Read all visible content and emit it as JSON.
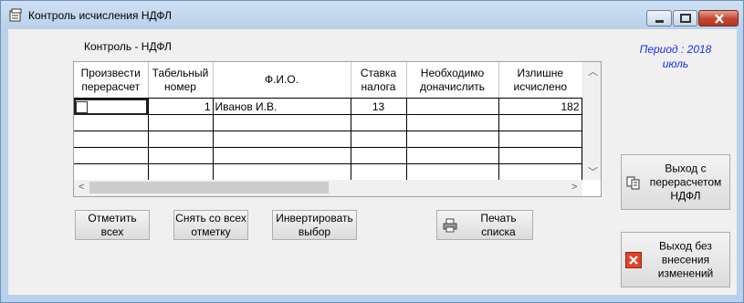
{
  "window": {
    "title": "Контроль исчисления НДФЛ"
  },
  "header": {
    "control_label": "Контроль - НДФЛ",
    "period_line1": "Период : 2018",
    "period_line2": "июль"
  },
  "table": {
    "columns": [
      "Произвести перерасчет",
      "Табельный номер",
      "Ф.И.О.",
      "Ставка налога",
      "Необходимо доначислить",
      "Излишне исчислено"
    ],
    "columns_split": [
      [
        "Произвести",
        "перерасчет"
      ],
      [
        "Табельный",
        "номер"
      ],
      [
        "Ф.И.О.",
        ""
      ],
      [
        "Ставка",
        "налога"
      ],
      [
        "Необходимо",
        "доначислить"
      ],
      [
        "Излишне",
        "исчислено"
      ]
    ],
    "rows": [
      {
        "recalc": false,
        "tab_number": "1",
        "fio": "Иванов И.В.",
        "rate": "13",
        "need_add": "",
        "excess": "182"
      }
    ],
    "empty_rows": 4
  },
  "buttons": {
    "select_all": [
      "Отметить",
      "всех"
    ],
    "clear_all": [
      "Снять со всех",
      "отметку"
    ],
    "invert": [
      "Инвертировать",
      "выбор"
    ],
    "print": [
      "Печать",
      "списка"
    ],
    "exit_recalc": [
      "Выход с",
      "перерасчетом",
      "НДФЛ"
    ],
    "exit_no_changes": [
      "Выход без",
      "внесения",
      "изменений"
    ]
  },
  "colors": {
    "period": "#1a2ef0",
    "close": "#c4432f"
  }
}
